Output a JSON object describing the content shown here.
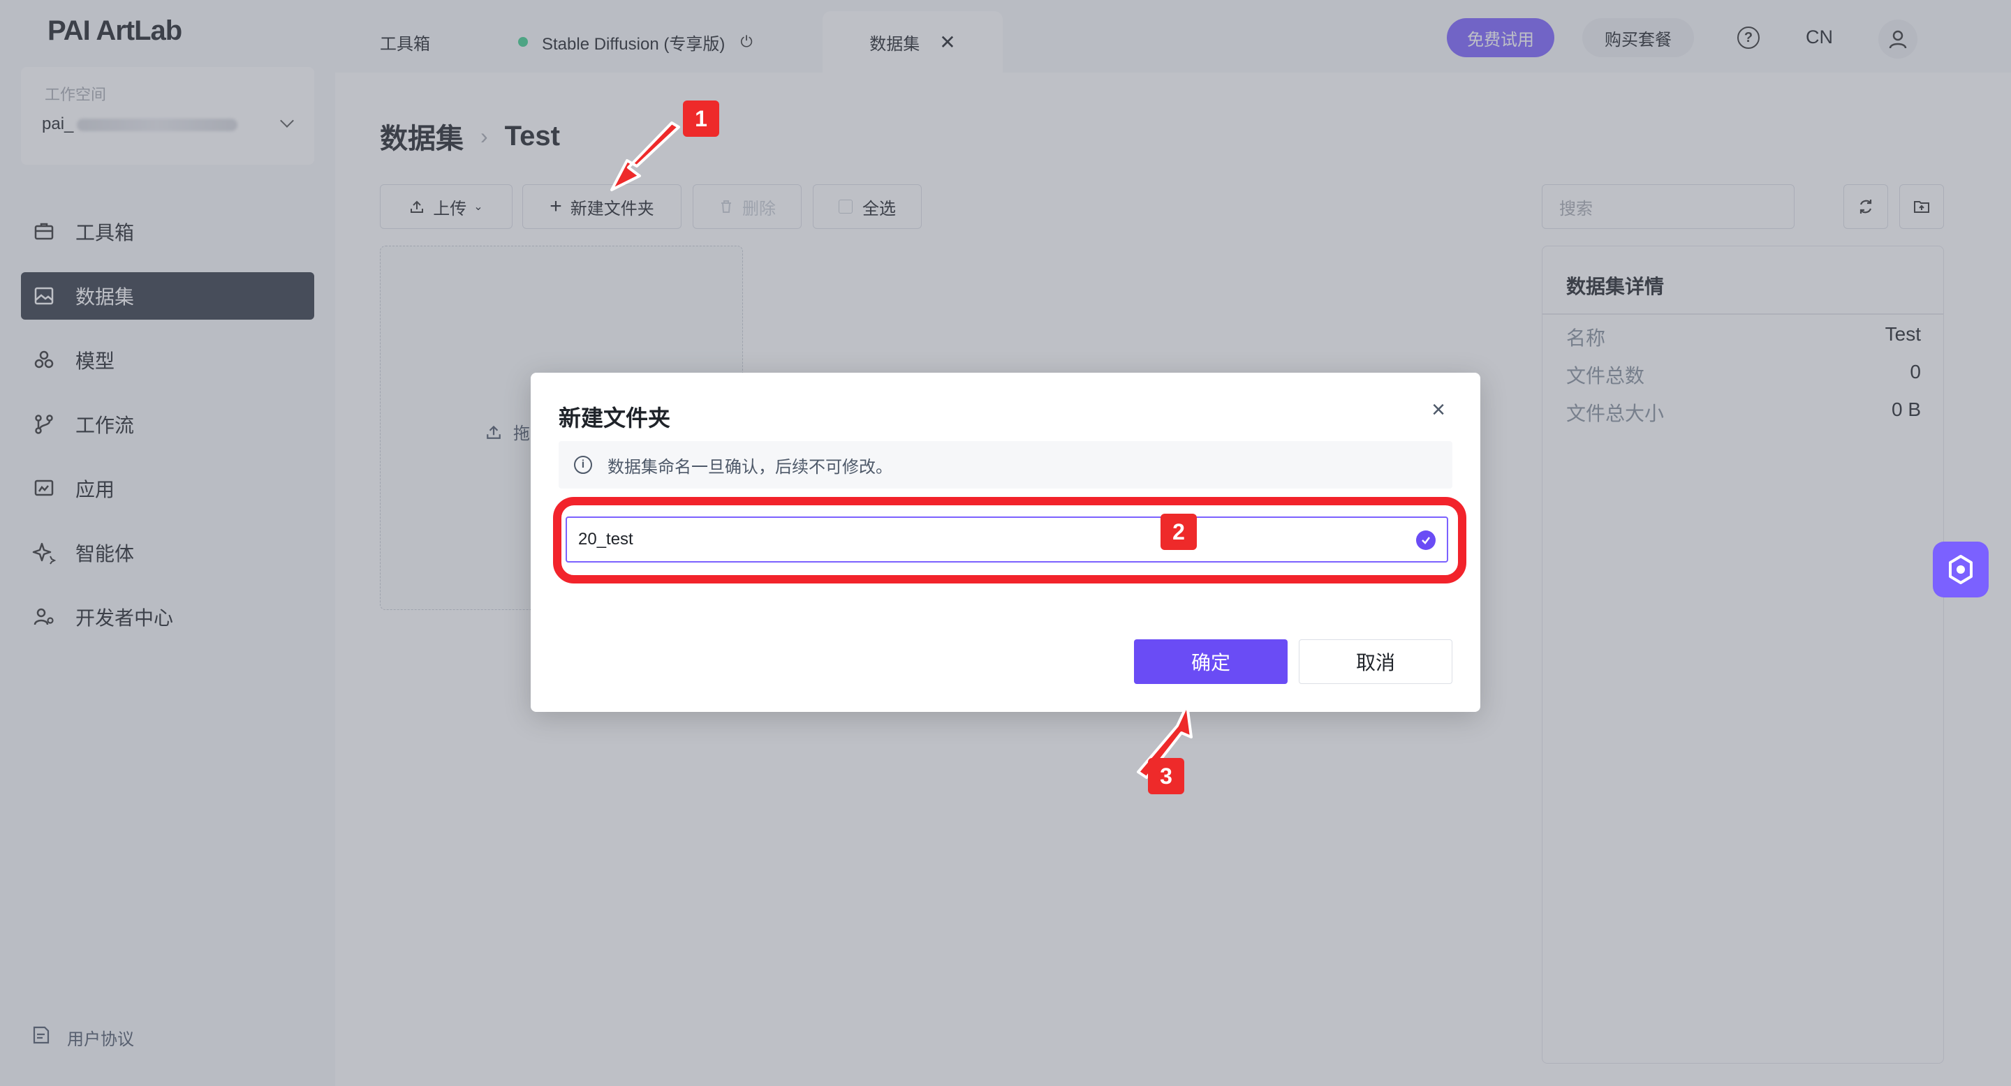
{
  "app": {
    "logo": "PAI ArtLab"
  },
  "tabs": [
    {
      "label": "工具箱"
    },
    {
      "label": "Stable Diffusion (专享版)"
    },
    {
      "label": "数据集"
    }
  ],
  "header": {
    "trial_label": "免费试用",
    "buy_label": "购买套餐",
    "lang": "CN"
  },
  "sidebar": {
    "workspace_label": "工作空间",
    "workspace_value": "pai_",
    "items": [
      {
        "label": "工具箱",
        "icon": "toolbox-icon"
      },
      {
        "label": "数据集",
        "icon": "image-icon",
        "active": true
      },
      {
        "label": "模型",
        "icon": "cubes-icon"
      },
      {
        "label": "工作流",
        "icon": "workflow-icon"
      },
      {
        "label": "应用",
        "icon": "app-icon"
      },
      {
        "label": "智能体",
        "icon": "sparkle-icon"
      },
      {
        "label": "开发者中心",
        "icon": "developer-icon"
      }
    ],
    "footer": "用户协议"
  },
  "main": {
    "breadcrumb": {
      "root": "数据集",
      "current": "Test"
    },
    "toolbar": {
      "upload": "上传",
      "new_folder": "新建文件夹",
      "delete": "删除",
      "select_all": "全选"
    },
    "dropzone_text": "拖",
    "search_placeholder": "搜索",
    "details": {
      "title": "数据集详情",
      "rows": [
        {
          "key": "名称",
          "value": "Test"
        },
        {
          "key": "文件总数",
          "value": "0"
        },
        {
          "key": "文件总大小",
          "value": "0 B"
        }
      ]
    }
  },
  "modal": {
    "title": "新建文件夹",
    "notice": "数据集命名一旦确认，后续不可修改。",
    "input_value": "20_test",
    "ok_label": "确定",
    "cancel_label": "取消"
  },
  "annotations": {
    "step1": "1",
    "step2": "2",
    "step3": "3"
  },
  "colors": {
    "accent": "#6a4cf5",
    "annotation": "#ee2a2a",
    "sidebar_active": "#333a45"
  }
}
